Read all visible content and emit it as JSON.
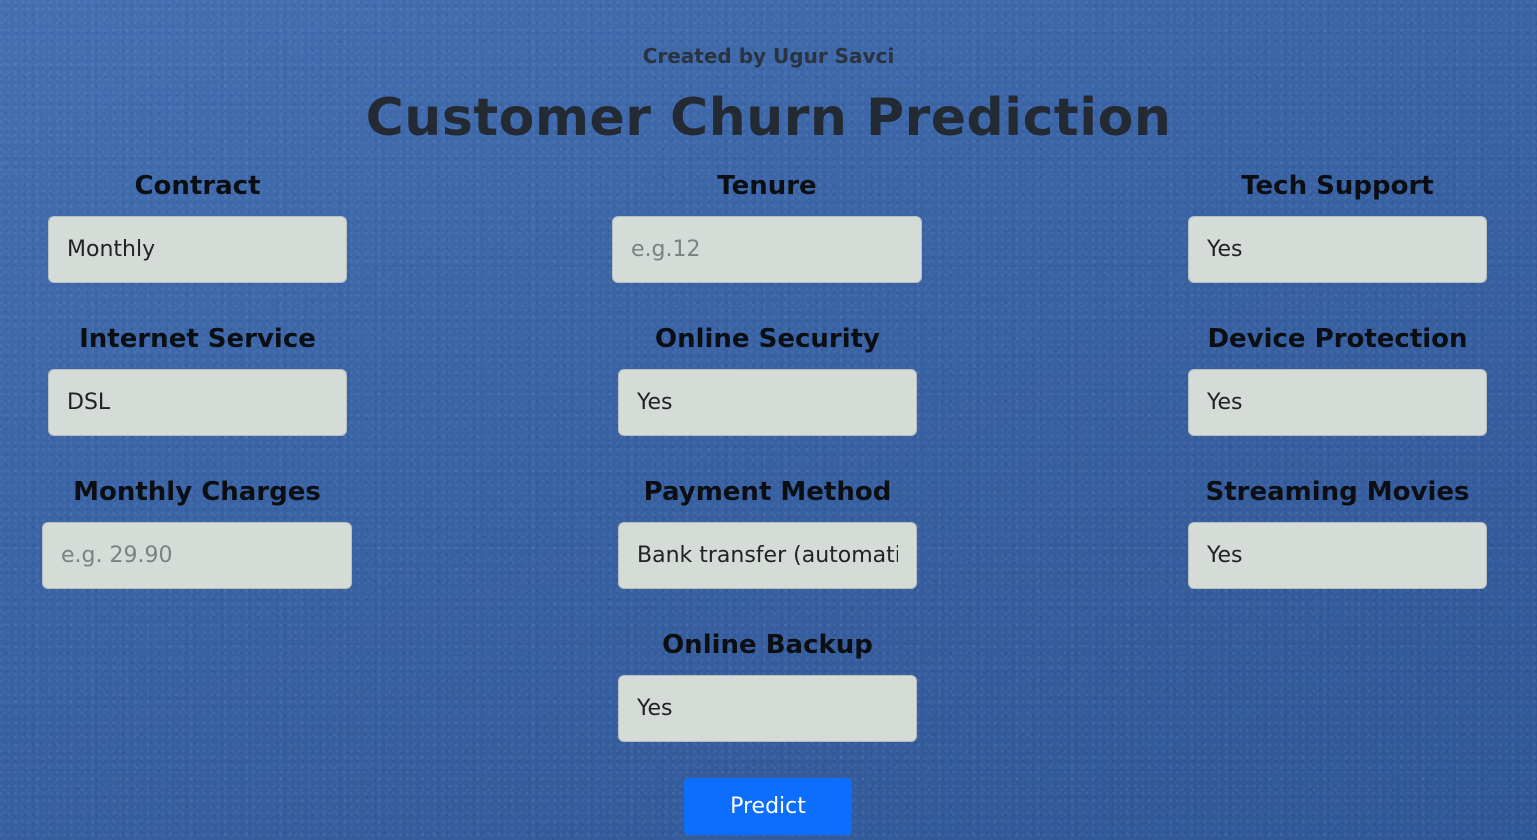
{
  "header": {
    "credit": "Created by Ugur Savci",
    "title": "Customer Churn Prediction"
  },
  "fields": {
    "contract": {
      "label": "Contract",
      "value": "Monthly"
    },
    "tenure": {
      "label": "Tenure",
      "value": "",
      "placeholder": "e.g.12"
    },
    "tech_support": {
      "label": "Tech Support",
      "value": "Yes"
    },
    "internet_service": {
      "label": "Internet Service",
      "value": "DSL"
    },
    "online_security": {
      "label": "Online Security",
      "value": "Yes"
    },
    "device_protection": {
      "label": "Device Protection",
      "value": "Yes"
    },
    "monthly_charges": {
      "label": "Monthly Charges",
      "value": "",
      "placeholder": "e.g. 29.90"
    },
    "payment_method": {
      "label": "Payment Method",
      "value": "Bank transfer (automatic)"
    },
    "streaming_movies": {
      "label": "Streaming Movies",
      "value": "Yes"
    },
    "online_backup": {
      "label": "Online Backup",
      "value": "Yes"
    }
  },
  "actions": {
    "predict_label": "Predict"
  },
  "colors": {
    "background": "#3a64a6",
    "input_background": "#d5dbd7",
    "button_primary": "#0d6efd"
  }
}
